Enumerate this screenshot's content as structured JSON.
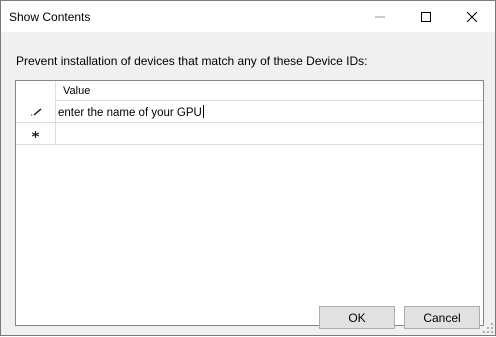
{
  "window": {
    "title": "Show Contents",
    "controls": {
      "minimize": "minimize-icon",
      "maximize": "maximize-icon",
      "close": "close-icon"
    }
  },
  "prompt": "Prevent installation of devices that match any of these Device IDs:",
  "grid": {
    "column_header": "Value",
    "rows": [
      {
        "indicator": "pencil-icon",
        "value": "enter the name of your GPU",
        "editing": true
      },
      {
        "indicator": "asterisk-icon",
        "value": ""
      }
    ]
  },
  "buttons": {
    "ok": "OK",
    "cancel": "Cancel"
  }
}
